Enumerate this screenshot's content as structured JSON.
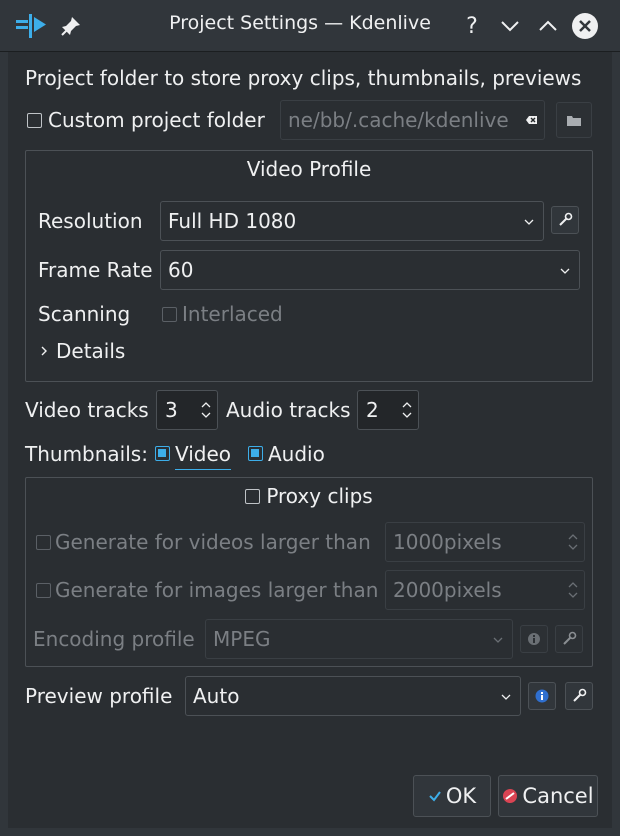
{
  "titlebar": {
    "title": "Project Settings — Kdenlive",
    "help_glyph": "?"
  },
  "project_folder": {
    "heading": "Project folder to store proxy clips, thumbnails, previews",
    "custom_label": "Custom project folder",
    "path_value": "ne/bb/.cache/kdenlive"
  },
  "video_profile": {
    "title": "Video Profile",
    "resolution_label": "Resolution",
    "resolution_value": "Full HD 1080",
    "frame_rate_label": "Frame Rate",
    "frame_rate_value": "60",
    "scanning_label": "Scanning",
    "interlaced_label": "Interlaced",
    "details_label": "Details"
  },
  "tracks": {
    "video_label": "Video tracks",
    "video_value": "3",
    "audio_label": "Audio tracks",
    "audio_value": "2"
  },
  "thumbnails": {
    "label": "Thumbnails:",
    "video_label": "Video",
    "audio_label": "Audio"
  },
  "proxy": {
    "title": "Proxy clips",
    "videos_label": "Generate for videos larger than",
    "videos_value": "1000pixels",
    "images_label": "Generate for images larger than",
    "images_value": "2000pixels",
    "encoding_label": "Encoding profile",
    "encoding_value": "MPEG"
  },
  "preview": {
    "label": "Preview profile",
    "value": "Auto"
  },
  "buttons": {
    "ok": "OK",
    "cancel": "Cancel"
  },
  "colors": {
    "accent": "#3daee9",
    "background": "#2a2e32",
    "cancel_red": "#da4453"
  }
}
